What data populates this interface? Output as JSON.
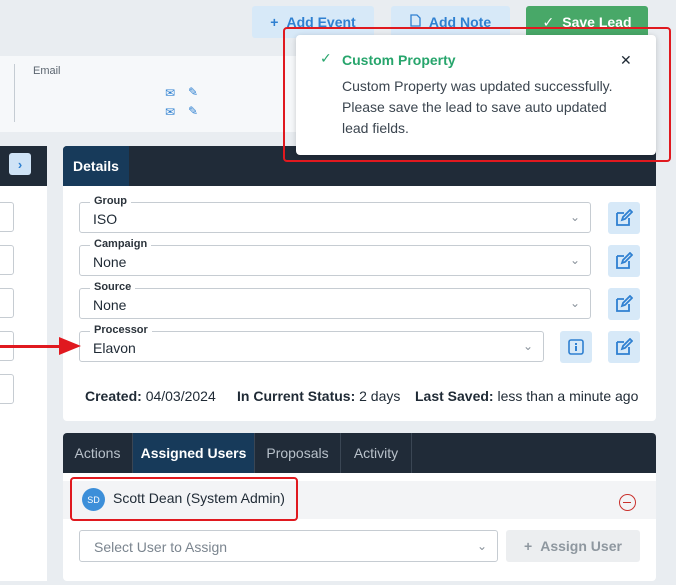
{
  "toolbar": {
    "add_event_label": "Add Event",
    "add_note_label": "Add Note",
    "save_lead_label": "Save Lead"
  },
  "contact": {
    "email_label": "Email"
  },
  "details": {
    "tab_label": "Details",
    "fields": {
      "group": {
        "label": "Group",
        "value": "ISO"
      },
      "campaign": {
        "label": "Campaign",
        "value": "None"
      },
      "source": {
        "label": "Source",
        "value": "None"
      },
      "processor": {
        "label": "Processor",
        "value": "Elavon"
      }
    },
    "created_label": "Created:",
    "created_value": "04/03/2024",
    "status_label": "In Current Status:",
    "status_value": "2 days",
    "saved_label": "Last Saved:",
    "saved_value": "less than a minute ago"
  },
  "users_panel": {
    "tabs": [
      "Actions",
      "Assigned Users",
      "Proposals",
      "Activity"
    ],
    "active_tab": "Assigned Users",
    "assigned_user": {
      "initials": "SD",
      "name": "Scott Dean (System Admin)"
    },
    "assign_placeholder": "Select User to Assign",
    "assign_button_label": "Assign User"
  },
  "toast": {
    "title": "Custom Property",
    "message": "Custom Property was updated successfully. Please save the lead to save auto updated lead fields."
  },
  "icons": {
    "close": "close-icon",
    "check": "check-icon",
    "edit": "edit-icon",
    "info": "info-icon",
    "mail": "mail-icon",
    "remove": "remove-circle-icon"
  },
  "colors": {
    "accent": "#2f80d1",
    "success": "#27a56c",
    "save_button": "#48a868",
    "header_dark": "#202b38",
    "tab_active": "#173a5a",
    "annotation": "#e0191f",
    "danger": "#c9302c"
  }
}
